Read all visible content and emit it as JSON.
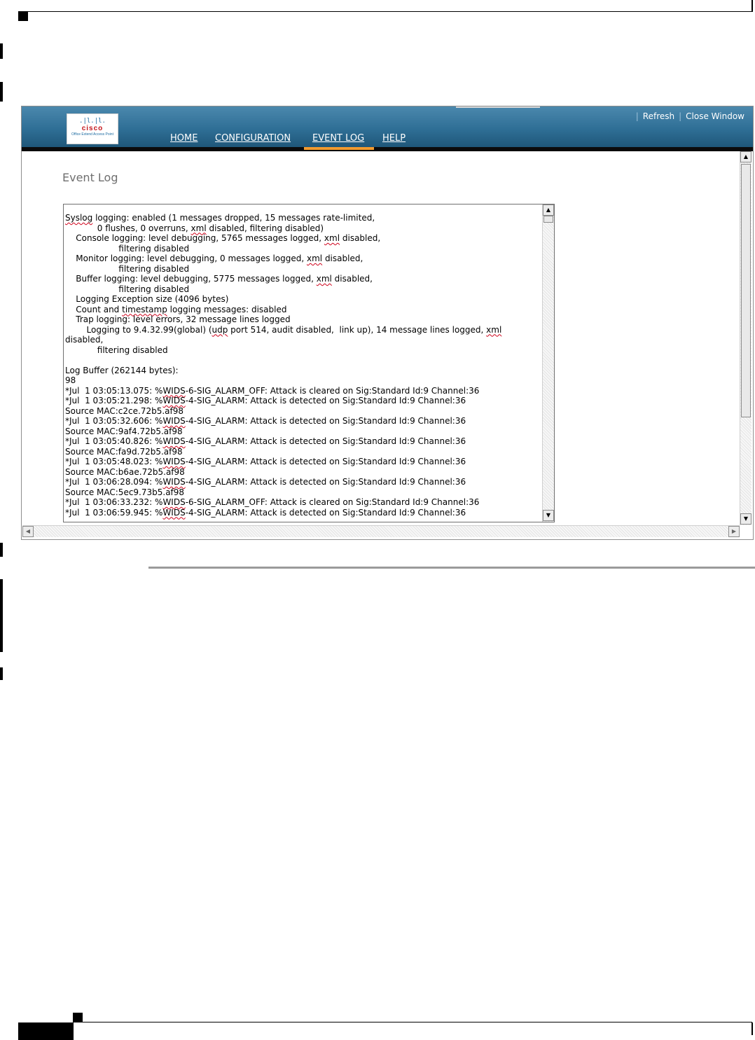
{
  "app": {
    "logo_text": "cisco",
    "logo_subtitle": "Office Extend Access Point"
  },
  "toplinks": {
    "refresh_label": "Refresh",
    "close_window_label": "Close Window"
  },
  "nav": {
    "items": [
      {
        "label": "HOME",
        "active": false
      },
      {
        "label": "CONFIGURATION",
        "active": false
      },
      {
        "label": "EVENT LOG",
        "active": true
      },
      {
        "label": "HELP",
        "active": false
      }
    ],
    "active_color": "#f29a2e"
  },
  "page": {
    "title": "Event Log"
  },
  "log": {
    "lines": [
      "Syslog logging: enabled (1 messages dropped, 15 messages rate-limited,",
      "            0 flushes, 0 overruns, xml disabled, filtering disabled)",
      "    Console logging: level debugging, 5765 messages logged, xml disabled,",
      "                    filtering disabled",
      "    Monitor logging: level debugging, 0 messages logged, xml disabled,",
      "                    filtering disabled",
      "    Buffer logging: level debugging, 5775 messages logged, xml disabled,",
      "                    filtering disabled",
      "    Logging Exception size (4096 bytes)",
      "    Count and timestamp logging messages: disabled",
      "    Trap logging: level errors, 32 message lines logged",
      "        Logging to 9.4.32.99(global) (udp port 514, audit disabled,  link up), 14 message lines logged, xml disabled,",
      "            filtering disabled",
      "",
      "Log Buffer (262144 bytes):",
      "98",
      "*Jul  1 03:05:13.075: %WIDS-6-SIG_ALARM_OFF: Attack is cleared on Sig:Standard Id:9 Channel:36",
      "*Jul  1 03:05:21.298: %WIDS-4-SIG_ALARM: Attack is detected on Sig:Standard Id:9 Channel:36",
      "Source MAC:c2ce.72b5.af98",
      "*Jul  1 03:05:32.606: %WIDS-4-SIG_ALARM: Attack is detected on Sig:Standard Id:9 Channel:36",
      "Source MAC:9af4.72b5.af98",
      "*Jul  1 03:05:40.826: %WIDS-4-SIG_ALARM: Attack is detected on Sig:Standard Id:9 Channel:36",
      "Source MAC:fa9d.72b5.af98",
      "*Jul  1 03:05:48.023: %WIDS-4-SIG_ALARM: Attack is detected on Sig:Standard Id:9 Channel:36",
      "Source MAC:b6ae.72b5.af98",
      "*Jul  1 03:06:28.094: %WIDS-4-SIG_ALARM: Attack is detected on Sig:Standard Id:9 Channel:36",
      "Source MAC:5ec9.73b5.af98",
      "*Jul  1 03:06:33.232: %WIDS-6-SIG_ALARM_OFF: Attack is cleared on Sig:Standard Id:9 Channel:36",
      "*Jul  1 03:06:59.945: %WIDS-4-SIG_ALARM: Attack is detected on Sig:Standard Id:9 Channel:36"
    ],
    "spellcheck_words": [
      "Syslog",
      "xml",
      "timestamp",
      "udp",
      "WIDS"
    ]
  },
  "colors": {
    "banner": "#2f6f96",
    "accent": "#f29a2e",
    "spellcheck": "#d0021b"
  }
}
